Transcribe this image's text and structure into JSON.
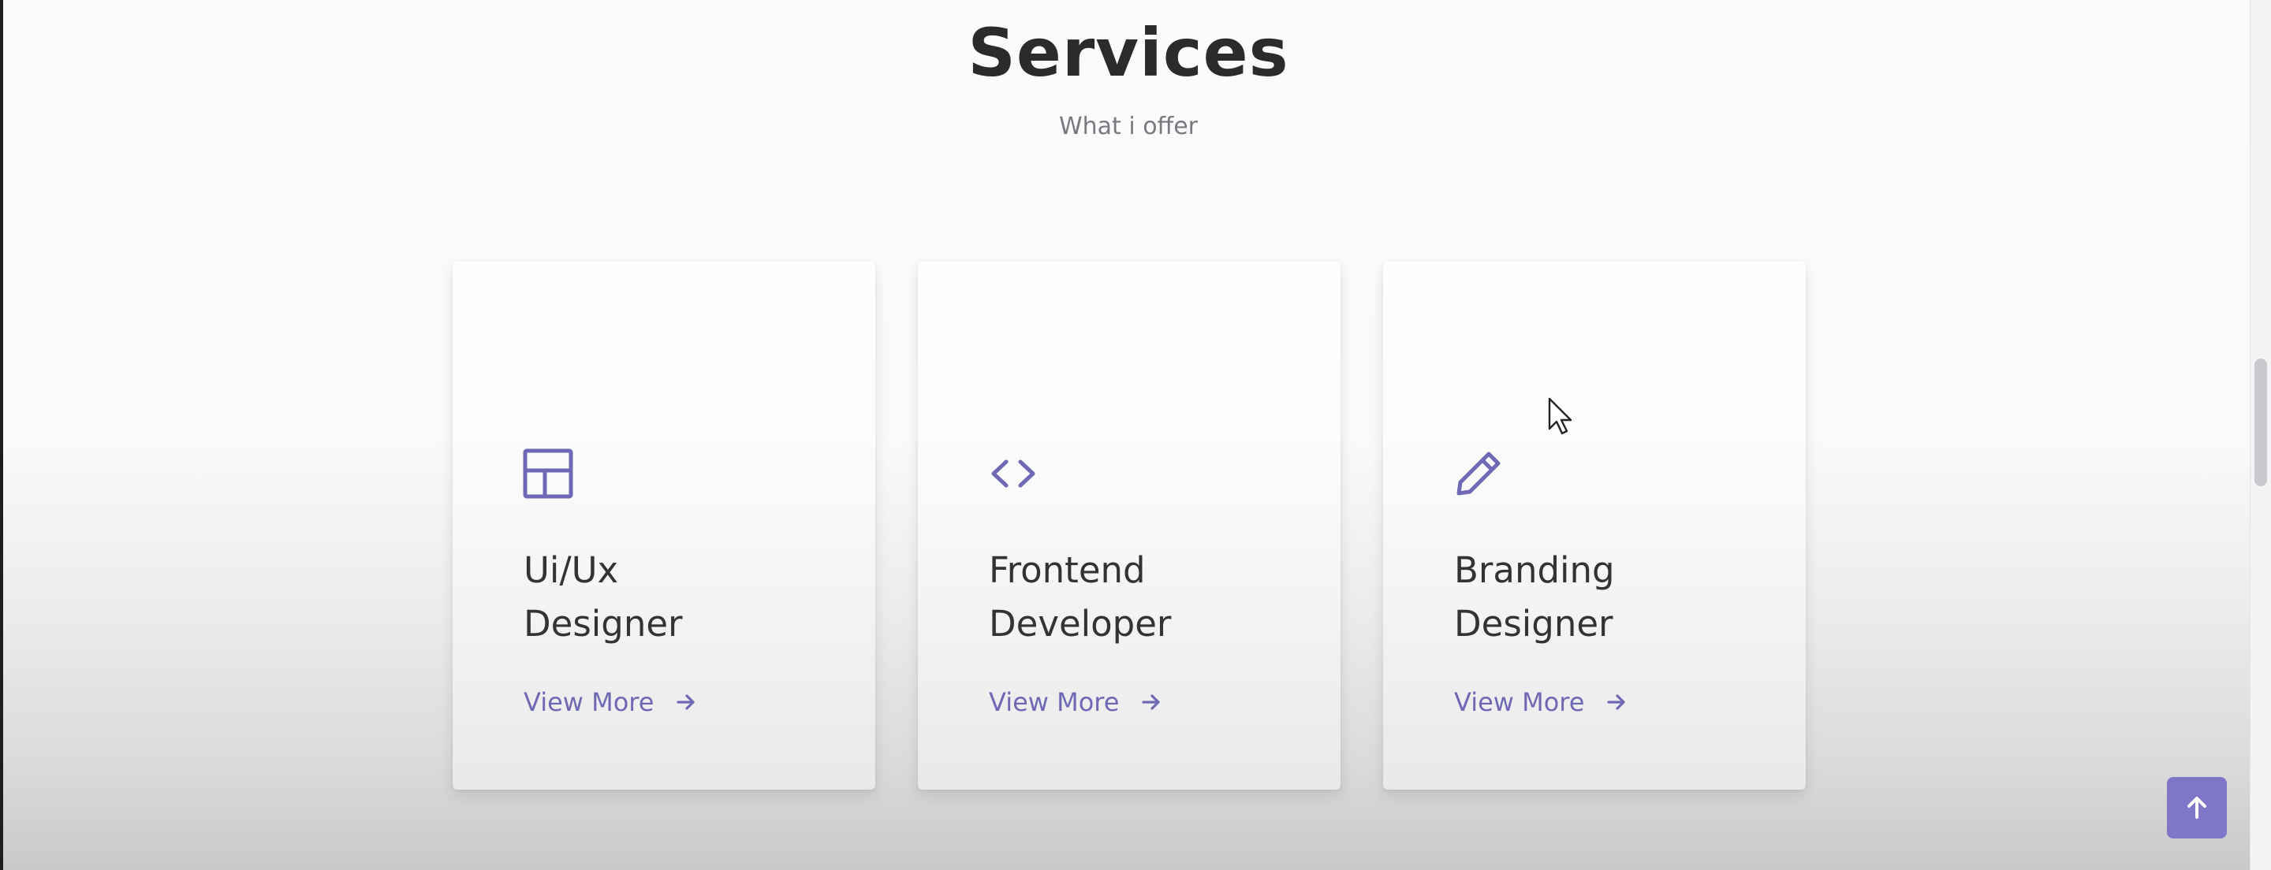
{
  "section": {
    "title": "Services",
    "subtitle": "What i offer"
  },
  "accent_color": "#6f69b5",
  "cards": [
    {
      "icon": "layout-grid-icon",
      "title_line1": "Ui/Ux",
      "title_line2": "Designer",
      "link_label": "View More"
    },
    {
      "icon": "code-brackets-icon",
      "title_line1": "Frontend",
      "title_line2": "Developer",
      "link_label": "View More"
    },
    {
      "icon": "pencil-icon",
      "title_line1": "Branding",
      "title_line2": "Designer",
      "link_label": "View More"
    }
  ],
  "scroll_top_button": {
    "icon": "arrow-up-icon"
  }
}
